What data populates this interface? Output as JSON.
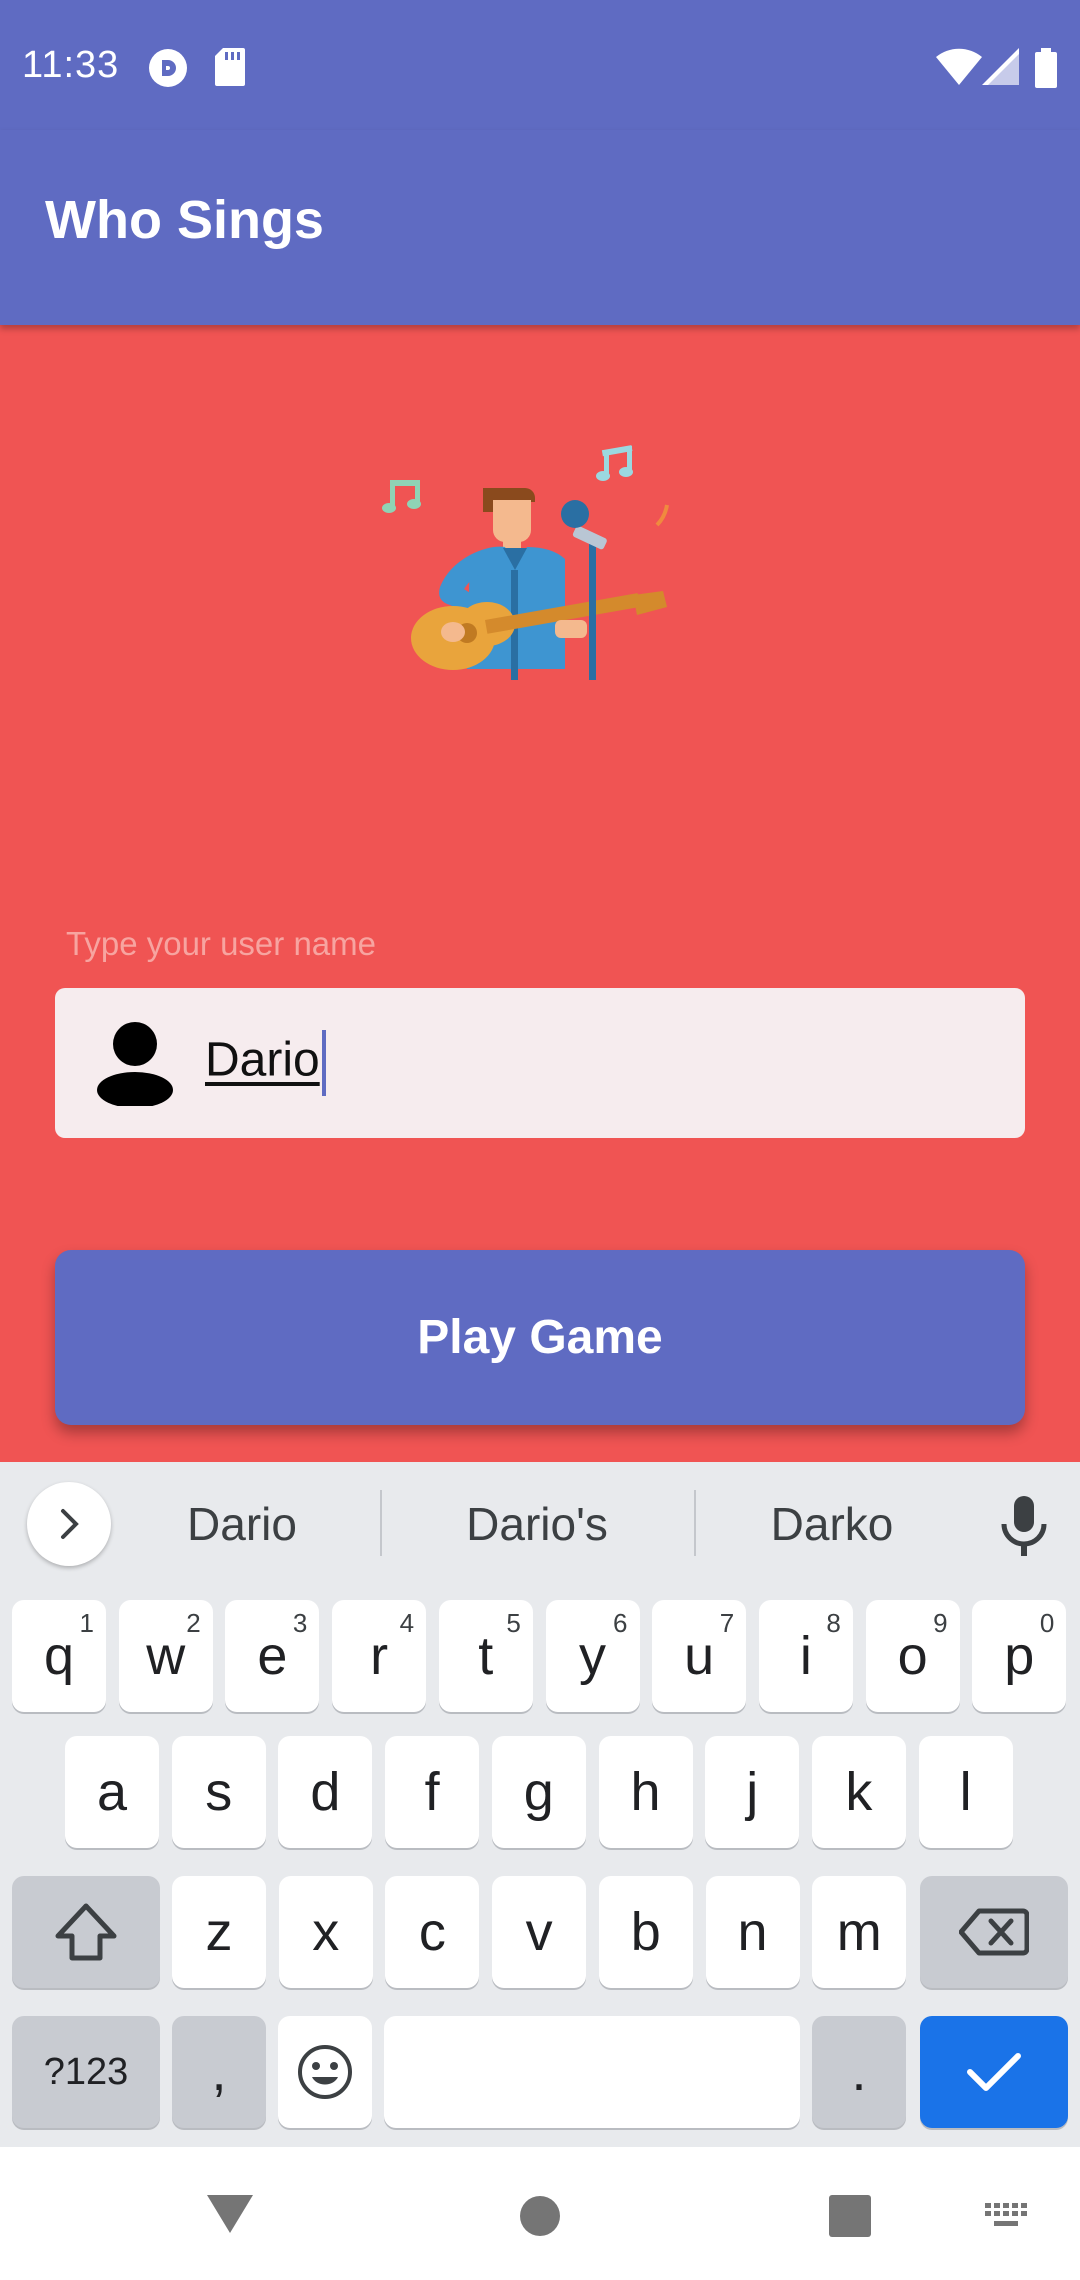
{
  "status_bar": {
    "time": "11:33",
    "icons": [
      "pocket-casts-icon",
      "sd-card-icon",
      "wifi-icon",
      "signal-icon",
      "battery-icon"
    ]
  },
  "app_bar": {
    "title": "Who Sings"
  },
  "main": {
    "illustration": "singer-with-guitar",
    "username_label": "Type your user name",
    "username_value": "Dario",
    "play_button_label": "Play Game"
  },
  "keyboard": {
    "suggestions": [
      "Dario",
      "Dario's",
      "Darko"
    ],
    "row1": [
      {
        "k": "q",
        "h": "1"
      },
      {
        "k": "w",
        "h": "2"
      },
      {
        "k": "e",
        "h": "3"
      },
      {
        "k": "r",
        "h": "4"
      },
      {
        "k": "t",
        "h": "5"
      },
      {
        "k": "y",
        "h": "6"
      },
      {
        "k": "u",
        "h": "7"
      },
      {
        "k": "i",
        "h": "8"
      },
      {
        "k": "o",
        "h": "9"
      },
      {
        "k": "p",
        "h": "0"
      }
    ],
    "row2": [
      "a",
      "s",
      "d",
      "f",
      "g",
      "h",
      "j",
      "k",
      "l"
    ],
    "row3": [
      "z",
      "x",
      "c",
      "v",
      "b",
      "n",
      "m"
    ],
    "symbols_label": "?123",
    "comma_label": ",",
    "period_label": "."
  },
  "colors": {
    "primary": "#5f6bc2",
    "background": "#f05453",
    "accent_enter": "#1a73e8"
  }
}
